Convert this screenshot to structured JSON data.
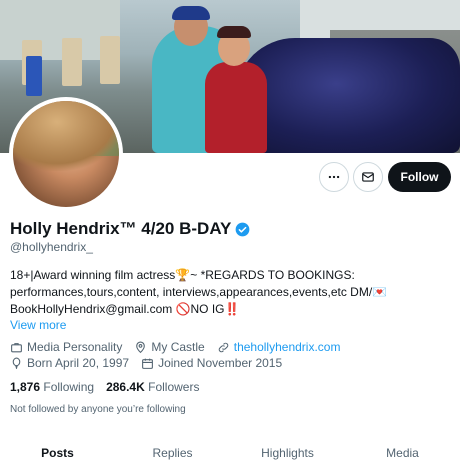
{
  "profile": {
    "name": "Holly Hendrix™ 4/20 B-DAY",
    "handle": "@hollyhendrix_",
    "bio_lines": [
      "18+|Award winning film actress🏆~ *REGARDS TO BOOKINGS:",
      "performances,tours,content, interviews,appearances,events,etc DM/💌",
      "BookHollyHendrix@gmail.com 🚫NO IG‼️"
    ],
    "view_more": "View more",
    "category": "Media Personality",
    "location": "My Castle",
    "website": "thehollyhendrix.com",
    "birthday": "Born April 20, 1997",
    "joined": "Joined November 2015",
    "following_count": "1,876",
    "following_label": "Following",
    "followers_count": "286.4K",
    "followers_label": "Followers",
    "not_followed": "Not followed by anyone you’re following"
  },
  "actions": {
    "follow_label": "Follow",
    "more_icon": "more-icon",
    "message_icon": "mail-icon"
  },
  "tabs": [
    {
      "label": "Posts",
      "active": true
    },
    {
      "label": "Replies",
      "active": false
    },
    {
      "label": "Highlights",
      "active": false
    },
    {
      "label": "Media",
      "active": false
    }
  ],
  "colors": {
    "accent": "#1d9bf0",
    "text": "#0f1419",
    "muted": "#536471",
    "follow_bg": "#0f1419"
  }
}
